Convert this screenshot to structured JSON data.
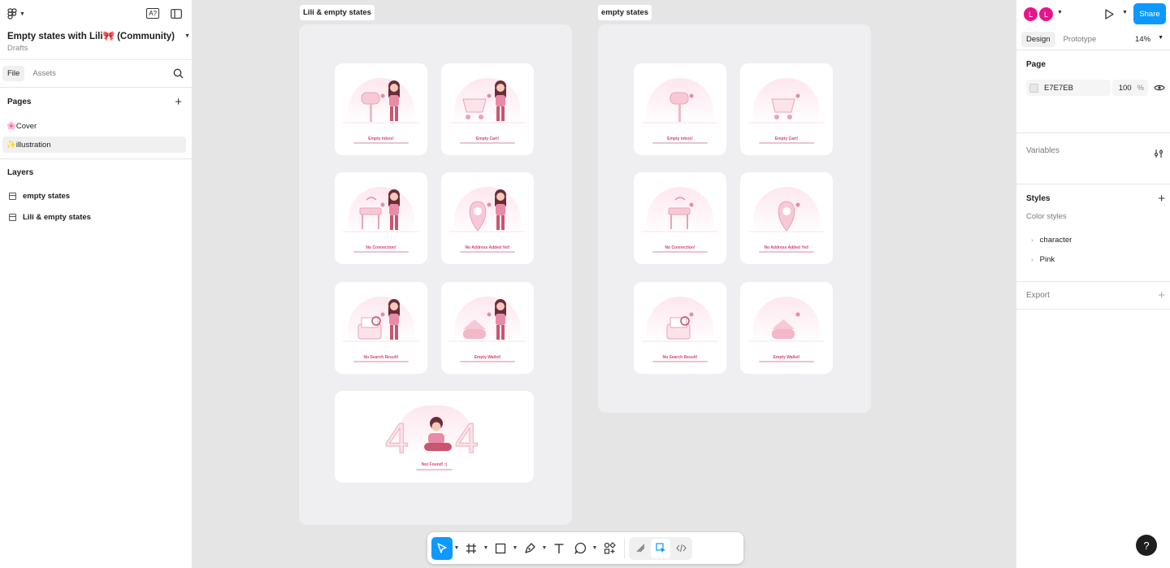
{
  "file": {
    "title": "Empty states with Lili🎀 (Community)",
    "location": "Drafts"
  },
  "left_tabs": [
    "File",
    "Assets"
  ],
  "pages": {
    "title": "Pages",
    "items": [
      "🌸Cover",
      "✨illustration"
    ]
  },
  "layers": {
    "title": "Layers",
    "items": [
      "empty states",
      "Lili & empty states"
    ]
  },
  "canvas": {
    "background": "#E5E5E5",
    "frames": [
      {
        "label": "Lili & empty states",
        "cards": [
          "Empty inbox!",
          "Empty Cart!",
          "No Connection!",
          "No Address Added Yet!",
          "No Search Result!",
          "Empty Wallet!",
          "Not Found! :("
        ]
      },
      {
        "label": "empty states",
        "cards": [
          "Empty inbox!",
          "Empty Cart!",
          "No Connection!",
          "No Address Added Yet!",
          "No Search Result!",
          "Empty Wallet!"
        ]
      }
    ]
  },
  "right": {
    "avatars": [
      "L",
      "L"
    ],
    "share_label": "Share",
    "tabs": [
      "Design",
      "Prototype"
    ],
    "zoom": "14%",
    "page_section": "Page",
    "page_color": "E7E7EB",
    "page_opacity": "100",
    "opacity_unit": "%",
    "variables": "Variables",
    "styles": "Styles",
    "color_styles": "Color styles",
    "style_items": [
      "character",
      "Pink"
    ],
    "export": "Export"
  },
  "help_label": "?",
  "colors": {
    "accent": "#0D99FF",
    "avatar": "#E8148C",
    "pink_text": "#D6456F"
  },
  "toolbar_icons": [
    "move-tool-icon",
    "frame-tool-icon",
    "rectangle-tool-icon",
    "pen-tool-icon",
    "text-tool-icon",
    "comment-tool-icon",
    "actions-icon",
    "draw-mode-icon",
    "design-mode-icon",
    "dev-mode-icon"
  ]
}
